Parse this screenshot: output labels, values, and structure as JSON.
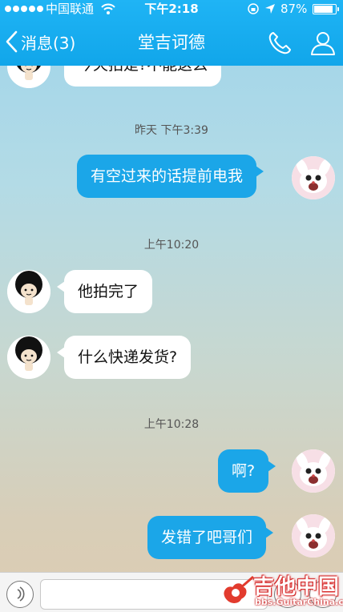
{
  "status_bar": {
    "carrier": "中国联通",
    "time": "下午2:18",
    "battery": "87%"
  },
  "nav": {
    "back_label": "消息(3)",
    "title": "堂吉诃德"
  },
  "messages": [
    {
      "type": "received",
      "text": "今天拍是?不能这么"
    },
    {
      "type": "timestamp",
      "text": "昨天 下午3:39"
    },
    {
      "type": "sent",
      "text": "有空过来的话提前电我"
    },
    {
      "type": "timestamp",
      "text": "上午10:20"
    },
    {
      "type": "received",
      "text": "他拍完了"
    },
    {
      "type": "received",
      "text": "什么快递发货?"
    },
    {
      "type": "timestamp",
      "text": "上午10:28"
    },
    {
      "type": "sent",
      "text": "啊?"
    },
    {
      "type": "sent",
      "text": "发错了吧哥们"
    }
  ],
  "input": {
    "placeholder": ""
  },
  "watermark": {
    "title": "吉他中国",
    "url": "bbs.GuitarChina.com"
  },
  "colors": {
    "header": "#15aaee",
    "sent_bubble": "#1ba6e8",
    "received_bubble": "#ffffff"
  }
}
